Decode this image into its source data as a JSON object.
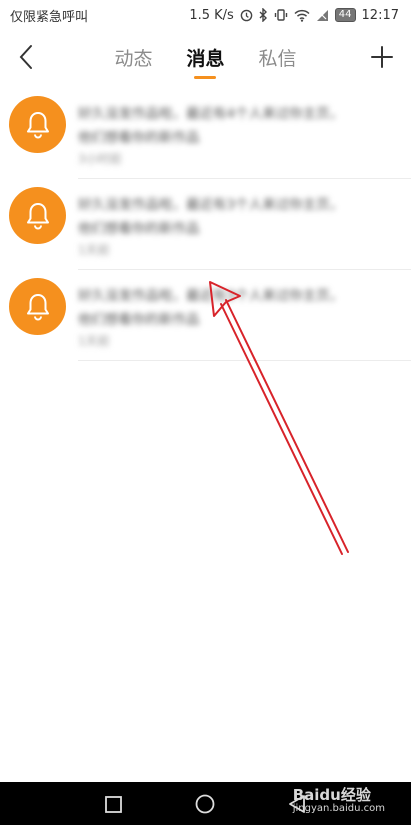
{
  "status_bar": {
    "left_text": "仅限紧急呼叫",
    "speed": "1.5 K/s",
    "battery": "44",
    "time": "12:17"
  },
  "header": {
    "tabs": [
      {
        "label": "动态",
        "active": false
      },
      {
        "label": "消息",
        "active": true
      },
      {
        "label": "私信",
        "active": false
      }
    ],
    "back_icon": "chevron-left-icon",
    "add_icon": "plus-icon"
  },
  "messages": [
    {
      "icon": "bell-icon",
      "line1": "好久没发作品啦，最近有4个人来过你主页，",
      "line2": "他们想看你的新作品",
      "time": "3小时前"
    },
    {
      "icon": "bell-icon",
      "line1": "好久没发作品啦，最近有3个人来过你主页，",
      "line2": "他们想看你的新作品",
      "time": "1天前"
    },
    {
      "icon": "bell-icon",
      "line1": "好久没发作品啦，最近有3个人来过你主页，",
      "line2": "他们想看你的新作品",
      "time": "1天前"
    }
  ],
  "colors": {
    "accent": "#f5901e",
    "annotation_arrow": "#d8232a"
  },
  "watermark": {
    "brand": "Baidu经验",
    "url": "jingyan.baidu.com"
  }
}
